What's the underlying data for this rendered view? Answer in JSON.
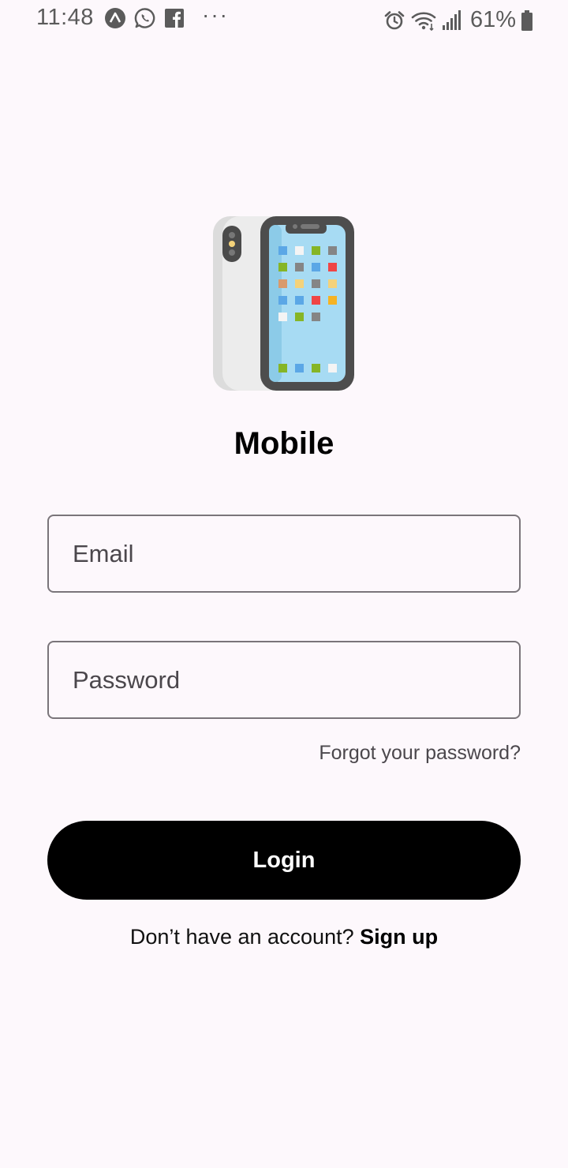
{
  "status_bar": {
    "time": "11:48",
    "left_icons": [
      "nav-icon",
      "whatsapp-icon",
      "facebook-icon"
    ],
    "more": "···",
    "right_icons": [
      "alarm-icon",
      "wifi-icon",
      "signal-icon"
    ],
    "battery_percent": "61%"
  },
  "hero": {
    "icon": "mobile-phone-illustration",
    "title": "Mobile"
  },
  "form": {
    "email": {
      "placeholder": "Email",
      "value": ""
    },
    "password": {
      "placeholder": "Password",
      "value": ""
    },
    "forgot_link": "Forgot your password?",
    "login_label": "Login"
  },
  "signup": {
    "prompt": "Don’t have an account? ",
    "link": "Sign up"
  },
  "colors": {
    "background": "#fdf8fc",
    "button": "#000000",
    "outline": "#7a757a",
    "secondary_text": "#4b474c"
  }
}
